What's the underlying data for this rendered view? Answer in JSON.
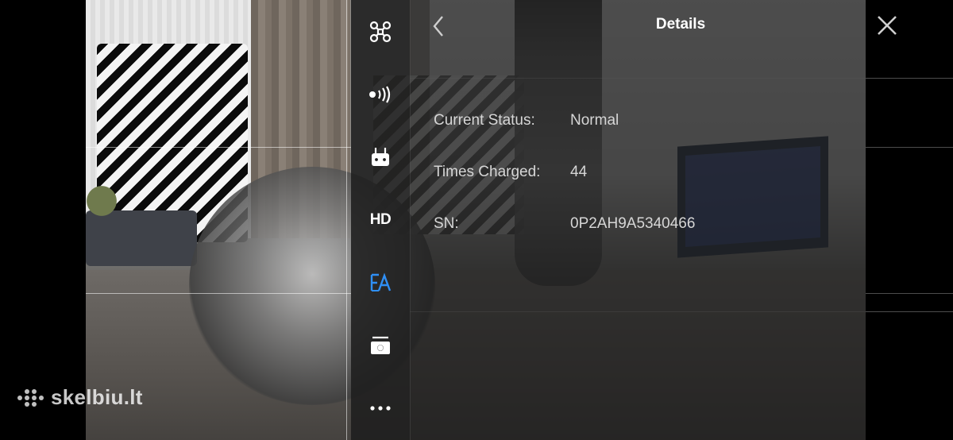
{
  "panel": {
    "title": "Details",
    "rows": [
      {
        "label": "Current Status:",
        "value": "Normal"
      },
      {
        "label": "Times Charged:",
        "value": "44"
      },
      {
        "label": "SN:",
        "value": "0P2AH9A5340466"
      }
    ]
  },
  "toolbar": {
    "items": [
      {
        "icon": "drone-icon"
      },
      {
        "icon": "signal-icon"
      },
      {
        "icon": "remote-controller-icon"
      },
      {
        "icon": "hd-icon",
        "label": "HD"
      },
      {
        "icon": "battery-intelligent-icon",
        "active": true
      },
      {
        "icon": "camera-icon"
      },
      {
        "icon": "more-icon"
      }
    ],
    "active_color": "#2f8ff5"
  },
  "watermark": {
    "text": "skelbiu.lt"
  }
}
